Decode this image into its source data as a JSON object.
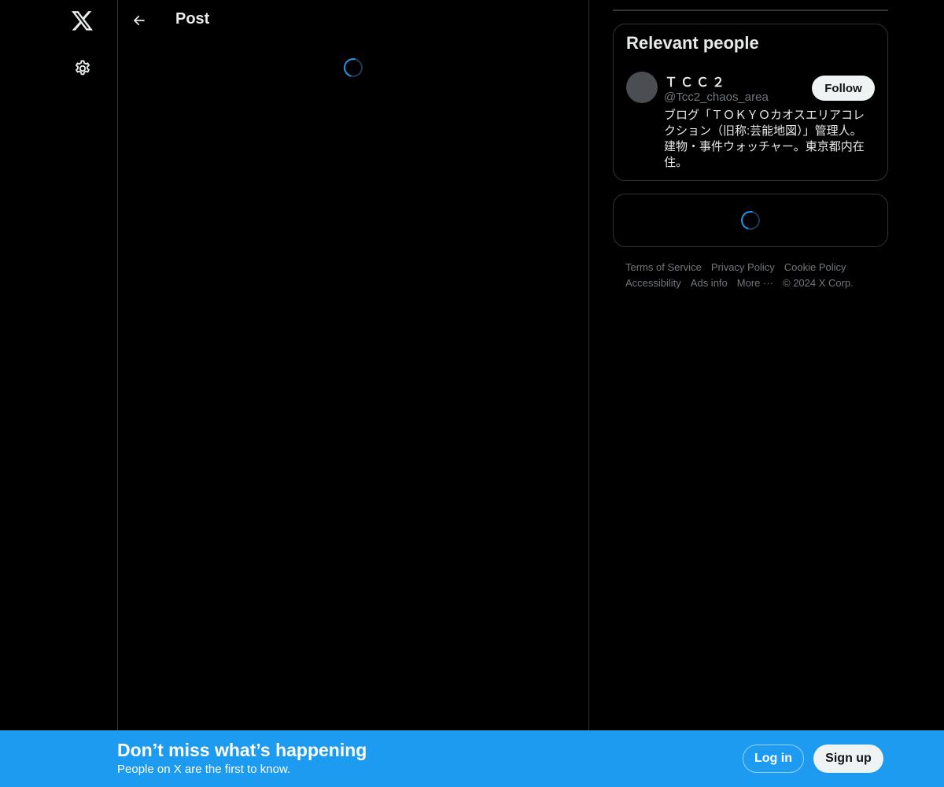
{
  "nav": {
    "logo_icon": "x-logo-icon",
    "settings_icon": "gear-icon"
  },
  "header": {
    "back_icon": "arrow-left-icon",
    "title": "Post"
  },
  "relevant_people": {
    "title": "Relevant people",
    "person": {
      "name": "ＴＣＣ２",
      "handle": "@Tcc2_chaos_area",
      "bio": "ブログ「ＴＯＫＹＯカオスエリアコレクション（旧称:芸能地図）」管理人。建物・事件ウォッチャー。東京都内在住。",
      "follow_label": "Follow"
    }
  },
  "footer": {
    "links": [
      "Terms of Service",
      "Privacy Policy",
      "Cookie Policy",
      "Accessibility",
      "Ads info",
      "More ···"
    ],
    "copyright": "© 2024 X Corp."
  },
  "banner": {
    "title": "Don’t miss what’s happening",
    "subtitle": "People on X are the first to know.",
    "login_label": "Log in",
    "signup_label": "Sign up"
  },
  "colors": {
    "accent": "#1d9bf0",
    "background": "#000000",
    "border": "#2f3336",
    "muted_text": "#71767b"
  }
}
